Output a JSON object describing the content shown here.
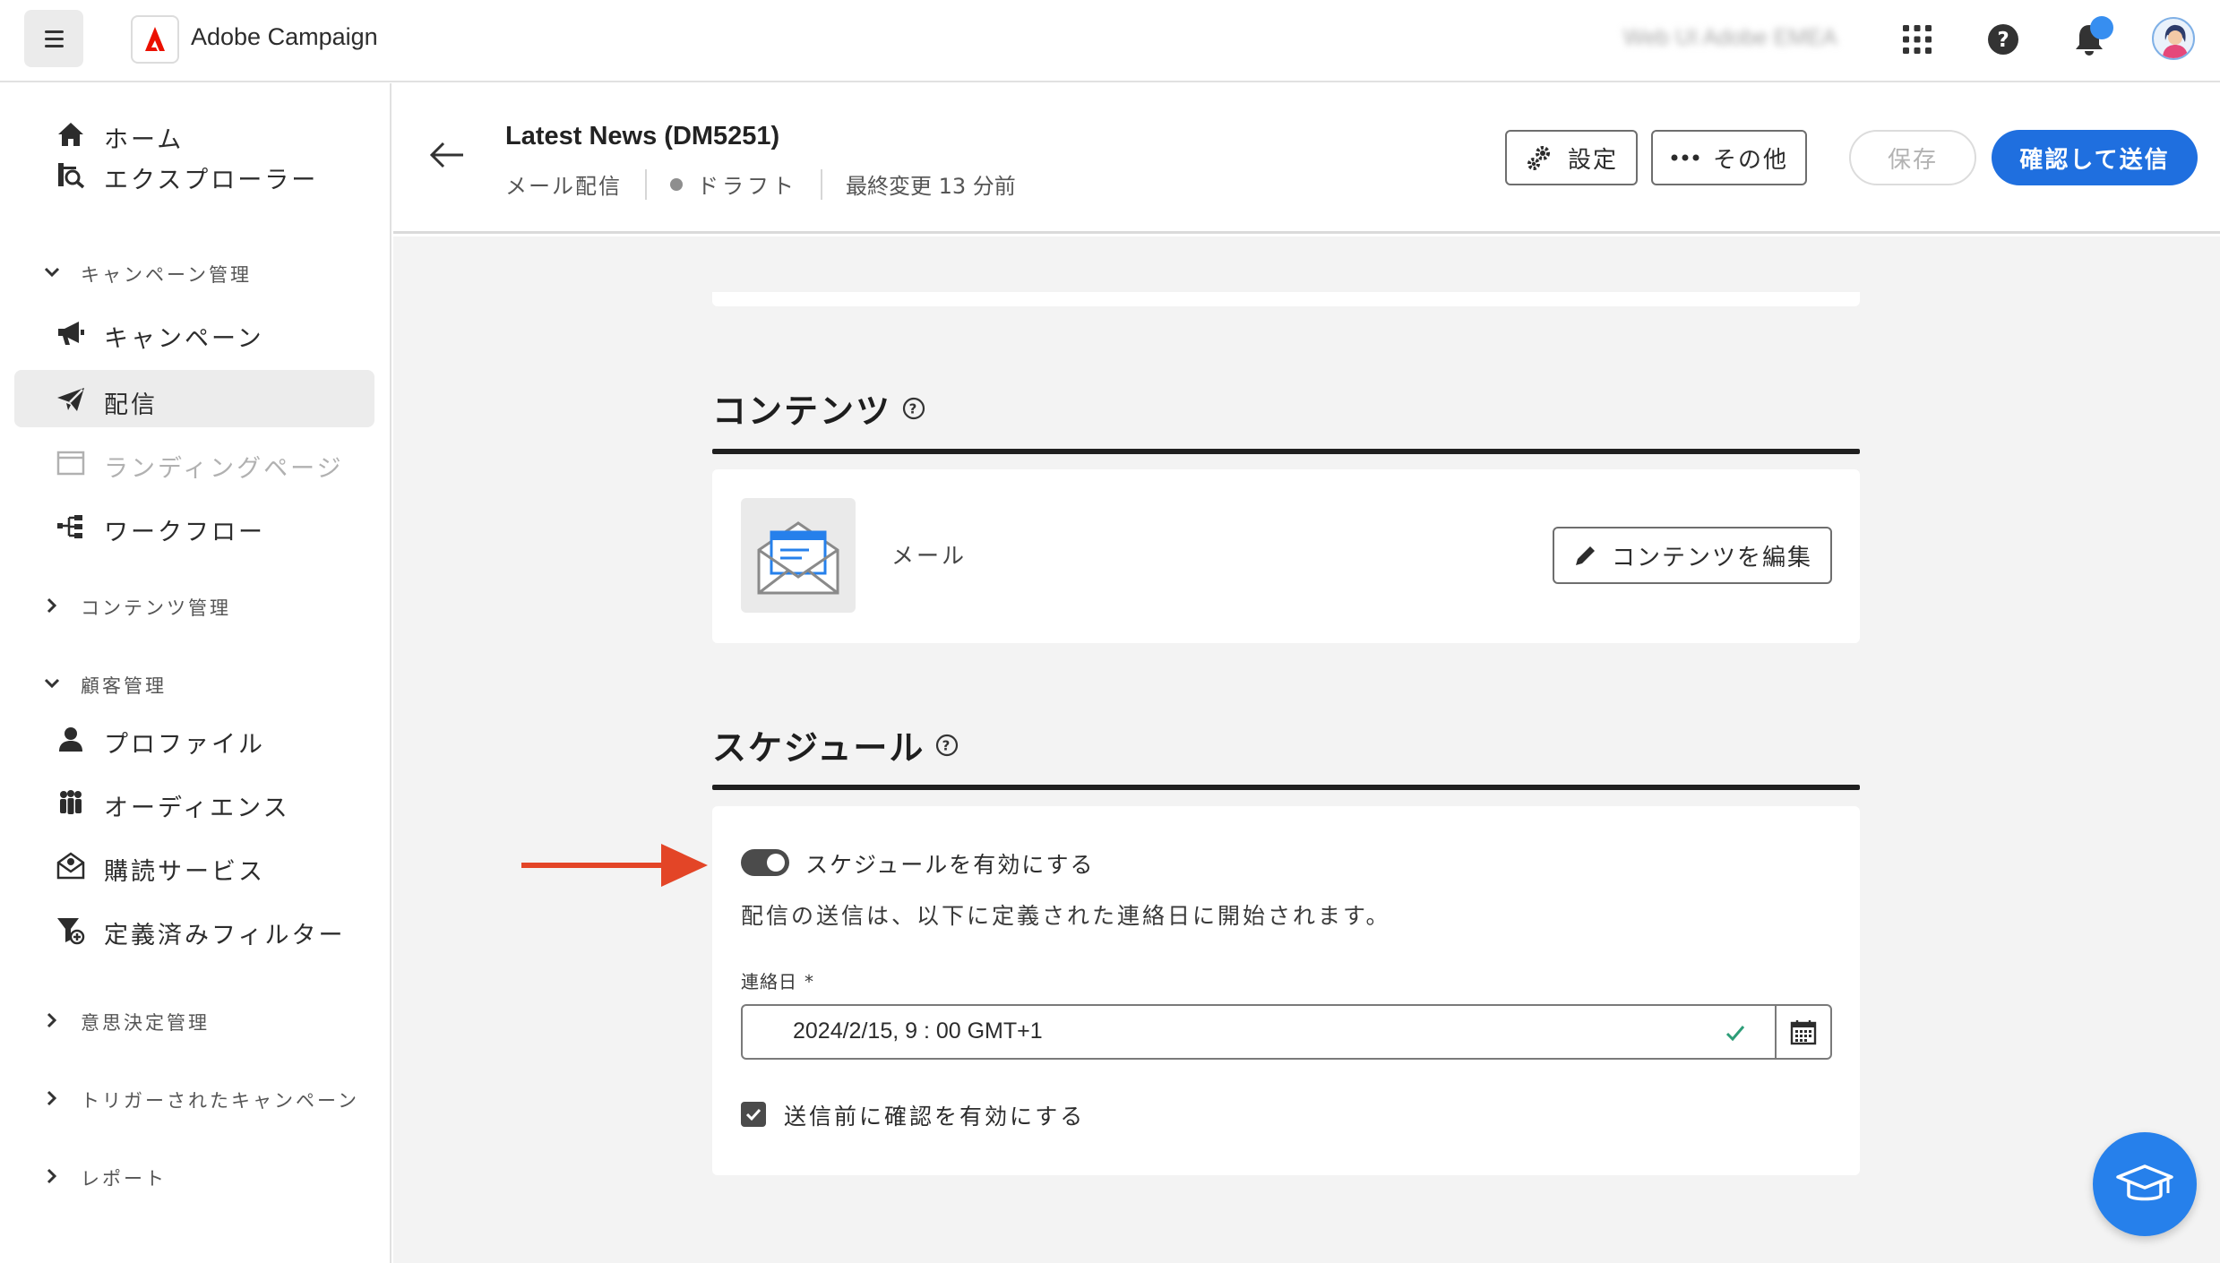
{
  "app": {
    "title": "Adobe Campaign",
    "org": "Web UI Adobe EMEA"
  },
  "topbar": {
    "menu_icon": "hamburger-icon",
    "apps_icon": "app-grid-icon",
    "help_icon": "help-icon",
    "notifications_icon": "bell-icon",
    "avatar_icon": "user-avatar-icon"
  },
  "sidebar": {
    "items": [
      {
        "label": "ホーム",
        "icon": "home-icon"
      },
      {
        "label": "エクスプローラー",
        "icon": "explorer-icon"
      }
    ],
    "groups": [
      {
        "label": "キャンペーン管理",
        "expanded": true,
        "items": [
          {
            "label": "キャンペーン",
            "icon": "megaphone-icon"
          },
          {
            "label": "配信",
            "icon": "send-icon",
            "active": true
          },
          {
            "label": "ランディングページ",
            "icon": "landing-page-icon",
            "disabled": true
          },
          {
            "label": "ワークフロー",
            "icon": "workflow-icon"
          }
        ]
      },
      {
        "label": "コンテンツ管理",
        "expanded": false
      },
      {
        "label": "顧客管理",
        "expanded": true,
        "items": [
          {
            "label": "プロファイル",
            "icon": "profile-icon"
          },
          {
            "label": "オーディエンス",
            "icon": "audience-icon"
          },
          {
            "label": "購読サービス",
            "icon": "subscription-icon"
          },
          {
            "label": "定義済みフィルター",
            "icon": "filter-icon"
          }
        ]
      },
      {
        "label": "意思決定管理",
        "expanded": false
      },
      {
        "label": "トリガーされたキャンペーン",
        "expanded": false
      },
      {
        "label": "レポート",
        "expanded": false
      }
    ]
  },
  "header": {
    "title": "Latest News (DM5251)",
    "channel": "メール配信",
    "status": "ドラフト",
    "modified": "最終変更 13 分前",
    "settings_label": "設定",
    "more_label": "その他",
    "save_label": "保存",
    "send_label": "確認して送信"
  },
  "content_section": {
    "title": "コンテンツ",
    "channel_label": "メール",
    "edit_label": "コンテンツを編集"
  },
  "schedule_section": {
    "title": "スケジュール",
    "toggle_label": "スケジュールを有効にする",
    "toggle_on": true,
    "description": "配信の送信は、以下に定義された連絡日に開始されます。",
    "date_label": "連絡日",
    "required_mark": "*",
    "date_value": "2024/2/15,   9 : 00   GMT+1",
    "confirm_label": "送信前に確認を有効にする",
    "confirm_checked": true
  },
  "colors": {
    "accent": "#1f6fdf",
    "annotation_arrow": "#e34527",
    "valid": "#2d9d78"
  }
}
